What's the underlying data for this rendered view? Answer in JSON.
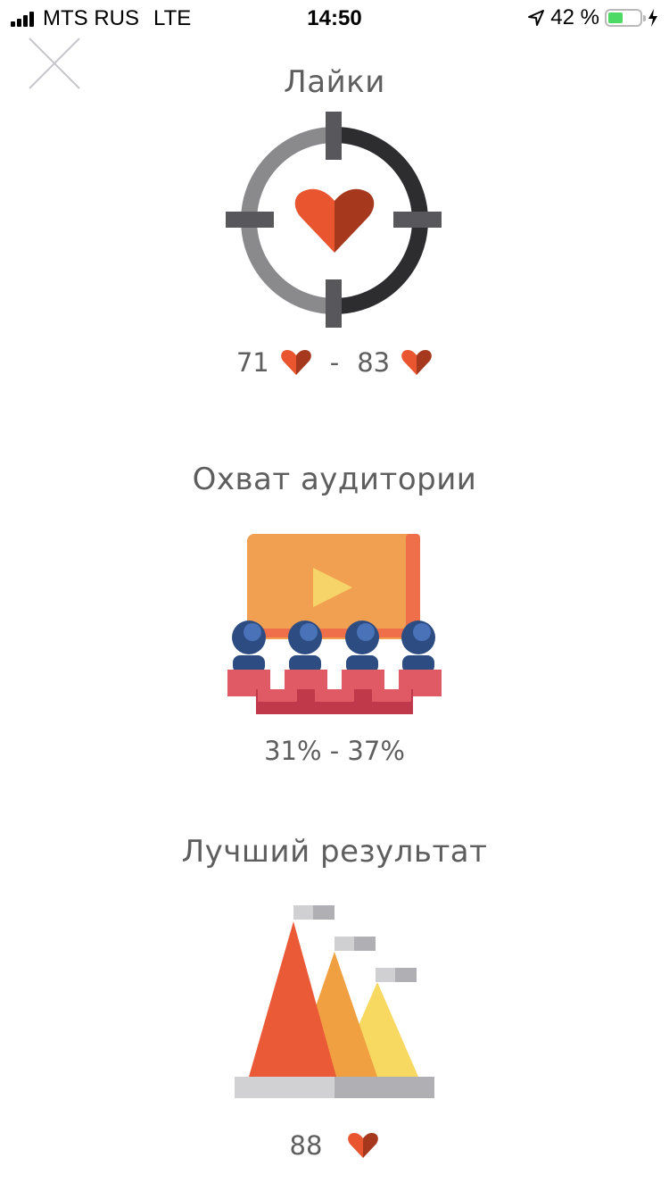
{
  "status_bar": {
    "carrier": "MTS RUS",
    "network": "LTE",
    "time": "14:50",
    "battery_percent": "42 %"
  },
  "close": {
    "icon": "close-x-icon"
  },
  "sections": {
    "likes": {
      "title": "Лайки",
      "min": "71",
      "sep": "-",
      "max": "83"
    },
    "reach": {
      "title": "Охват аудитории",
      "value": "31% - 37%"
    },
    "best": {
      "title": "Лучший результат",
      "value": "88"
    }
  },
  "colors": {
    "heart_left": "#e8552f",
    "heart_right": "#a5381d",
    "crosshair_light": "#8a8a8d",
    "crosshair_dark": "#2d2d30",
    "screen": "#f0a050",
    "seat": "#e05a65",
    "person": "#2c4c82",
    "mountain_1": "#ea5a36",
    "mountain_2": "#f0a040",
    "mountain_3": "#f7d860"
  }
}
